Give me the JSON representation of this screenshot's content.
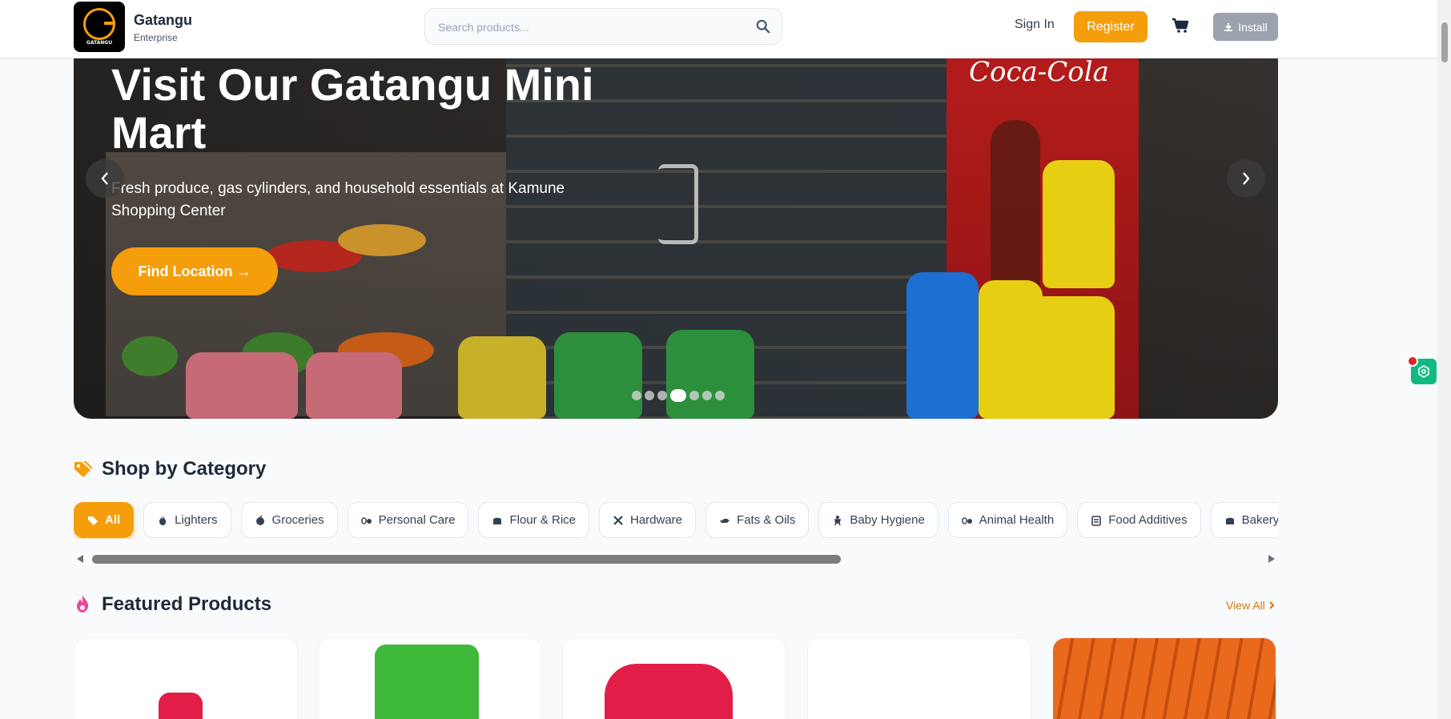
{
  "header": {
    "brand_name": "Gatangu",
    "brand_sub": "Enterprise",
    "logo_text": "GATANGU",
    "search_placeholder": "Search products...",
    "signin_label": "Sign In",
    "register_label": "Register",
    "install_label": "Install"
  },
  "hero": {
    "title": "Visit Our Gatangu Mini Mart",
    "subtitle": "Fresh produce, gas cylinders, and household essentials at Kamune Shopping Center",
    "button_label": "Find Location →",
    "slide_count": 7,
    "active_slide": 4,
    "sign_text": "Coca-Cola"
  },
  "categories": {
    "title": "Shop by Category",
    "items": [
      {
        "label": "All",
        "icon": "tags-icon",
        "active": true
      },
      {
        "label": "Lighters",
        "icon": "fire-icon"
      },
      {
        "label": "Groceries",
        "icon": "apple-icon"
      },
      {
        "label": "Personal Care",
        "icon": "pills-icon"
      },
      {
        "label": "Flour & Rice",
        "icon": "bread-icon"
      },
      {
        "label": "Hardware",
        "icon": "tools-icon"
      },
      {
        "label": "Fats & Oils",
        "icon": "oil-can-icon"
      },
      {
        "label": "Baby Hygiene",
        "icon": "baby-icon"
      },
      {
        "label": "Animal Health",
        "icon": "pills-icon"
      },
      {
        "label": "Food Additives",
        "icon": "clipboard-icon"
      },
      {
        "label": "Bakery",
        "icon": "bread-icon"
      },
      {
        "label": "",
        "icon": "cocktail-icon"
      }
    ]
  },
  "featured": {
    "title": "Featured Products",
    "view_all_label": "View All"
  },
  "colors": {
    "accent": "#f59e0b",
    "flame": "#ec4899",
    "widget": "#10b981"
  }
}
